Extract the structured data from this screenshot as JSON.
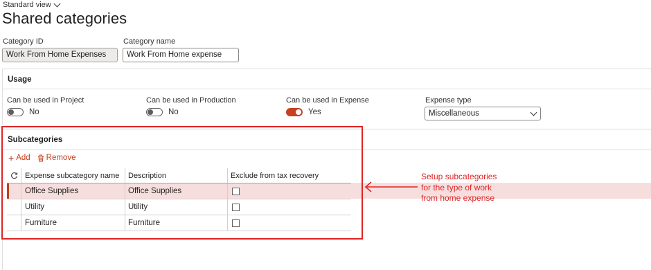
{
  "header": {
    "view_label": "Standard view",
    "title": "Shared categories"
  },
  "fields": {
    "category_id_label": "Category ID",
    "category_id_value": "Work From Home Expenses",
    "category_name_label": "Category name",
    "category_name_value": "Work From Home expense"
  },
  "usage": {
    "title": "Usage",
    "toggles": [
      {
        "label": "Can be used in Project",
        "value": "No",
        "on": false
      },
      {
        "label": "Can be used in Production",
        "value": "No",
        "on": false
      },
      {
        "label": "Can be used in Expense",
        "value": "Yes",
        "on": true
      }
    ],
    "expense_type_label": "Expense type",
    "expense_type_value": "Miscellaneous"
  },
  "subcategories": {
    "title": "Subcategories",
    "add_label": "Add",
    "remove_label": "Remove",
    "columns": [
      "Expense subcategory name",
      "Description",
      "Exclude from tax recovery"
    ],
    "rows": [
      {
        "name": "Office Supplies",
        "description": "Office Supplies",
        "exclude": false
      },
      {
        "name": "Utility",
        "description": "Utility",
        "exclude": false
      },
      {
        "name": "Furniture",
        "description": "Furniture",
        "exclude": false
      }
    ]
  },
  "annotation": {
    "line1": "Setup subcategories",
    "line2": "for the type of work",
    "line3": "from home expense",
    "color": "#e02424"
  },
  "colors": {
    "accent": "#c43e1c",
    "selected_row": "#f6dede"
  }
}
